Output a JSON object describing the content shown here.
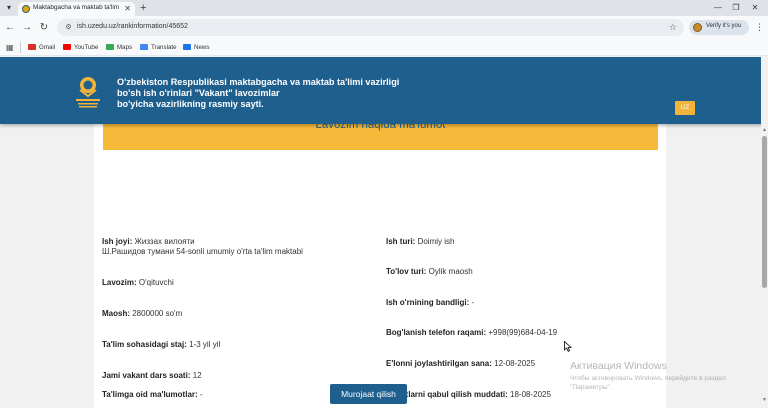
{
  "browser": {
    "tab_title": "Maktabgacha va maktab ta'lim",
    "url": "ish.uzedu.uz/rankinformation/45652",
    "verify_label": "Verify it's you",
    "bookmarks": [
      {
        "label": "Gmail",
        "color": "#d93025"
      },
      {
        "label": "YouTube",
        "color": "#ff0000"
      },
      {
        "label": "Maps",
        "color": "#34a853"
      },
      {
        "label": "Translate",
        "color": "#4285f4"
      },
      {
        "label": "News",
        "color": "#1a73e8"
      }
    ]
  },
  "header": {
    "line1": "O'zbekiston Respublikasi maktabgacha va maktab ta'limi vazirligi",
    "line2": "bo'sh ish o'rinlari \"Vakant\" lavozimlar",
    "line3": "bo'yicha vazirlikning rasmiy sayti.",
    "lang": "UZ"
  },
  "card": {
    "banner": "Lavozim haqida ma'lumot",
    "left": [
      {
        "label": "Ish joyi:",
        "value": "Жиззах вилояти",
        "value2": "Ш.Рашидов тумани 54-sonli umumiy o'rta ta'lim maktabi"
      },
      {
        "label": "Lavozim:",
        "value": "O'qituvchi"
      },
      {
        "label": "Maosh:",
        "value": "2800000 so'm"
      },
      {
        "label": "Ta'lim sohasidagi staj:",
        "value": "1-3 yil yil"
      },
      {
        "label": "Jami vakant dars soati:",
        "value": "12"
      },
      {
        "label": "Ta'limga oid ma'lumotlar:",
        "value": "-"
      }
    ],
    "right": [
      {
        "label": "Ish turi:",
        "value": "Doimiy ish"
      },
      {
        "label": "To'lov turi:",
        "value": "Oylik maosh"
      },
      {
        "label": "Ish o'rnining bandligi:",
        "value": "-"
      },
      {
        "label": "Bog'lanish telefon raqami:",
        "value": "+998(99)684-04-19"
      },
      {
        "label": "E'lonni joylashtirilgan sana:",
        "value": "12-08-2025"
      },
      {
        "label": "Hujjatlarni qabul qilish muddati:",
        "value": "18-08-2025"
      }
    ],
    "apply_button": "Murojaat qilish"
  },
  "watermark": {
    "title": "Активация Windows",
    "line1": "Чтобы активировать Windows, перейдите в раздел",
    "line2": "\"Параметры\"."
  },
  "colors": {
    "header_blue": "#1e5f8e",
    "banner_orange": "#f6b93a"
  }
}
